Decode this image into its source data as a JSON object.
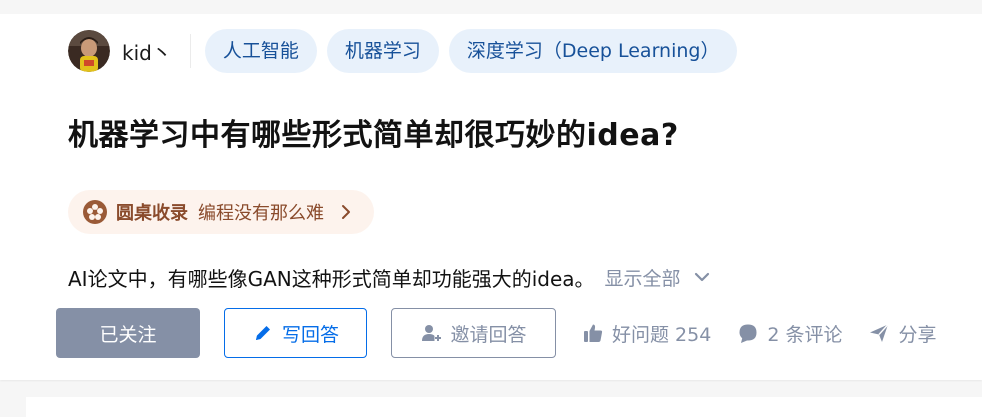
{
  "question": {
    "author": "kid丶",
    "tags": [
      "人工智能",
      "机器学习",
      "深度学习（Deep Learning）"
    ],
    "title": "机器学习中有哪些形式简单却很巧妙的idea?",
    "roundtable": {
      "label": "圆桌收录",
      "name": "编程没有那么难"
    },
    "excerpt": "AI论文中，有哪些像GAN这种形式简单却功能强大的idea。",
    "show_all": "显示全部"
  },
  "actions": {
    "followed": "已关注",
    "write_answer": "写回答",
    "invite": "邀请回答",
    "good_question": "好问题 254",
    "comments": "2 条评论",
    "share": "分享"
  },
  "icons": {
    "avatar": "avatar-icon",
    "roundtable": "flower-icon",
    "chevron_right": "chevron-right-icon",
    "chevron_down": "chevron-down-icon",
    "pencil": "pencil-icon",
    "invite": "add-user-icon",
    "thumb": "thumbs-up-icon",
    "comment": "comment-icon",
    "share": "share-icon"
  },
  "colors": {
    "tag_bg": "#e8f1fb",
    "tag_text": "#175199",
    "primary": "#056de8",
    "muted": "#8590a6",
    "roundtable_bg": "#fdf3ed",
    "roundtable_text": "#8a4b2c",
    "title": "#121212"
  }
}
